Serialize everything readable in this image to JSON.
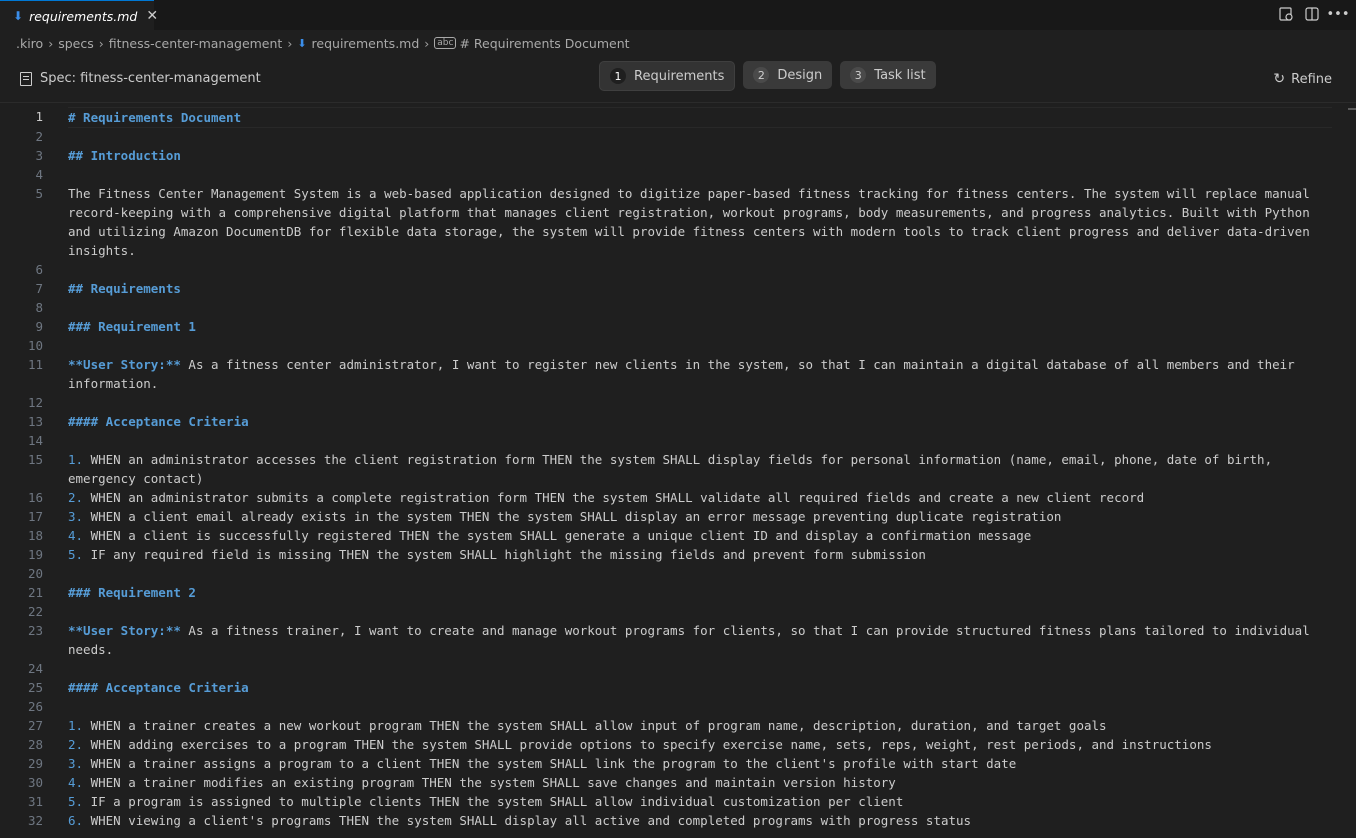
{
  "tab": {
    "title": "requirements.md",
    "close": "✕"
  },
  "breadcrumb": [
    ".kiro",
    "specs",
    "fitness-center-management",
    "requirements.md",
    "# Requirements Document"
  ],
  "spec": {
    "label": "Spec: fitness-center-management"
  },
  "steps": [
    {
      "num": "1",
      "label": "Requirements"
    },
    {
      "num": "2",
      "label": "Design"
    },
    {
      "num": "3",
      "label": "Task list"
    }
  ],
  "refine_label": "Refine",
  "lines": [
    {
      "n": "1",
      "parts": [
        {
          "t": "# Requirements Document",
          "c": "heading"
        }
      ]
    },
    {
      "n": "2",
      "parts": []
    },
    {
      "n": "3",
      "parts": [
        {
          "t": "## Introduction",
          "c": "heading"
        }
      ]
    },
    {
      "n": "4",
      "parts": []
    },
    {
      "n": "5",
      "parts": [
        {
          "t": "The Fitness Center Management System is a web-based application designed to digitize paper-based fitness tracking for fitness centers. The system will replace manual record-keeping with a comprehensive digital platform that manages client registration, workout programs, body measurements, and progress analytics. Built with Python and utilizing Amazon DocumentDB for flexible data storage, the system will provide fitness centers with modern tools to track client progress and deliver data-driven insights.",
          "c": ""
        }
      ]
    },
    {
      "n": "6",
      "parts": []
    },
    {
      "n": "7",
      "parts": [
        {
          "t": "## Requirements",
          "c": "heading"
        }
      ]
    },
    {
      "n": "8",
      "parts": []
    },
    {
      "n": "9",
      "parts": [
        {
          "t": "### Requirement 1",
          "c": "heading"
        }
      ]
    },
    {
      "n": "10",
      "parts": []
    },
    {
      "n": "11",
      "parts": [
        {
          "t": "**User Story:**",
          "c": "bold-lead"
        },
        {
          "t": " As a fitness center administrator, I want to register new clients in the system, so that I can maintain a digital database of all members and their information.",
          "c": ""
        }
      ]
    },
    {
      "n": "12",
      "parts": []
    },
    {
      "n": "13",
      "parts": [
        {
          "t": "#### Acceptance Criteria",
          "c": "heading"
        }
      ]
    },
    {
      "n": "14",
      "parts": []
    },
    {
      "n": "15",
      "parts": [
        {
          "t": "1.",
          "c": "list-num"
        },
        {
          "t": " WHEN an administrator accesses the client registration form THEN the system SHALL display fields for personal information (name, email, phone, date of birth, emergency contact)",
          "c": ""
        }
      ]
    },
    {
      "n": "16",
      "parts": [
        {
          "t": "2.",
          "c": "list-num"
        },
        {
          "t": " WHEN an administrator submits a complete registration form THEN the system SHALL validate all required fields and create a new client record",
          "c": ""
        }
      ]
    },
    {
      "n": "17",
      "parts": [
        {
          "t": "3.",
          "c": "list-num"
        },
        {
          "t": " WHEN a client email already exists in the system THEN the system SHALL display an error message preventing duplicate registration",
          "c": ""
        }
      ]
    },
    {
      "n": "18",
      "parts": [
        {
          "t": "4.",
          "c": "list-num"
        },
        {
          "t": " WHEN a client is successfully registered THEN the system SHALL generate a unique client ID and display a confirmation message",
          "c": ""
        }
      ]
    },
    {
      "n": "19",
      "parts": [
        {
          "t": "5.",
          "c": "list-num"
        },
        {
          "t": " IF any required field is missing THEN the system SHALL highlight the missing fields and prevent form submission",
          "c": ""
        }
      ]
    },
    {
      "n": "20",
      "parts": []
    },
    {
      "n": "21",
      "parts": [
        {
          "t": "### Requirement 2",
          "c": "heading"
        }
      ]
    },
    {
      "n": "22",
      "parts": []
    },
    {
      "n": "23",
      "parts": [
        {
          "t": "**User Story:**",
          "c": "bold-lead"
        },
        {
          "t": " As a fitness trainer, I want to create and manage workout programs for clients, so that I can provide structured fitness plans tailored to individual needs.",
          "c": ""
        }
      ]
    },
    {
      "n": "24",
      "parts": []
    },
    {
      "n": "25",
      "parts": [
        {
          "t": "#### Acceptance Criteria",
          "c": "heading"
        }
      ]
    },
    {
      "n": "26",
      "parts": []
    },
    {
      "n": "27",
      "parts": [
        {
          "t": "1.",
          "c": "list-num"
        },
        {
          "t": " WHEN a trainer creates a new workout program THEN the system SHALL allow input of program name, description, duration, and target goals",
          "c": ""
        }
      ]
    },
    {
      "n": "28",
      "parts": [
        {
          "t": "2.",
          "c": "list-num"
        },
        {
          "t": " WHEN adding exercises to a program THEN the system SHALL provide options to specify exercise name, sets, reps, weight, rest periods, and instructions",
          "c": ""
        }
      ]
    },
    {
      "n": "29",
      "parts": [
        {
          "t": "3.",
          "c": "list-num"
        },
        {
          "t": " WHEN a trainer assigns a program to a client THEN the system SHALL link the program to the client's profile with start date",
          "c": ""
        }
      ]
    },
    {
      "n": "30",
      "parts": [
        {
          "t": "4.",
          "c": "list-num"
        },
        {
          "t": " WHEN a trainer modifies an existing program THEN the system SHALL save changes and maintain version history",
          "c": ""
        }
      ]
    },
    {
      "n": "31",
      "parts": [
        {
          "t": "5.",
          "c": "list-num"
        },
        {
          "t": " IF a program is assigned to multiple clients THEN the system SHALL allow individual customization per client",
          "c": ""
        }
      ]
    },
    {
      "n": "32",
      "parts": [
        {
          "t": "6.",
          "c": "list-num"
        },
        {
          "t": " WHEN viewing a client's programs THEN the system SHALL display all active and completed programs with progress status",
          "c": ""
        }
      ]
    }
  ],
  "colors": {
    "heading": "#569cd6",
    "text": "#cccccc",
    "background": "#1f1f1f",
    "accent": "#0078d4"
  }
}
